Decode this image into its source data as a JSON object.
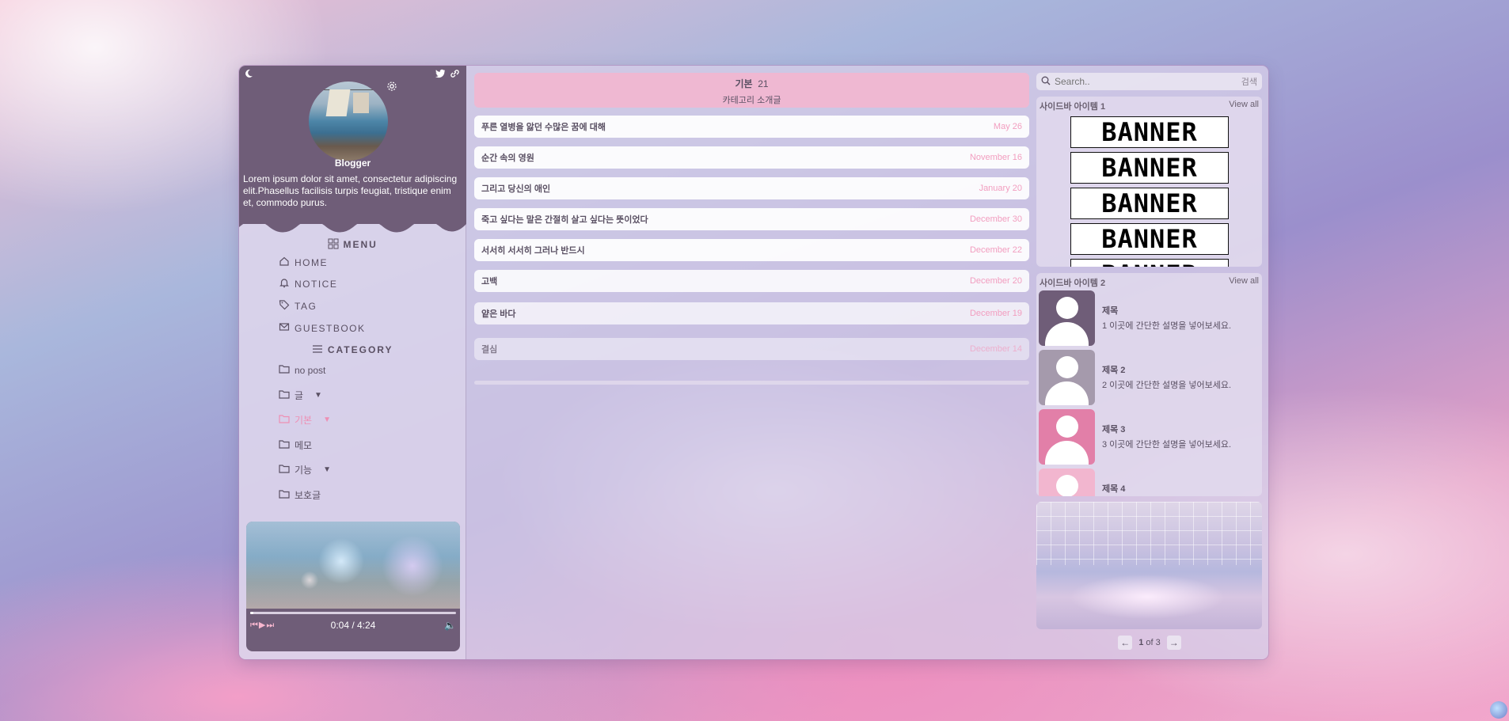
{
  "profile": {
    "name": "Blogger",
    "description": "Lorem ipsum dolor sit amet, consectetur adipiscing elit.Phasellus facilisis turpis feugiat, tristique enim et, commodo purus.",
    "icons": {
      "theme": "moon-icon",
      "twitter": "twitter-icon",
      "link": "link-icon",
      "settings": "gear-icon"
    }
  },
  "menu": {
    "title": "MENU",
    "items": [
      {
        "label": "HOME",
        "icon": "home-icon"
      },
      {
        "label": "NOTICE",
        "icon": "bell-icon"
      },
      {
        "label": "TAG",
        "icon": "tag-icon"
      },
      {
        "label": "GUESTBOOK",
        "icon": "mail-icon"
      }
    ]
  },
  "category": {
    "title": "CATEGORY",
    "items": [
      {
        "label": "no post",
        "icon": "folder-icon"
      },
      {
        "label": "글",
        "icon": "folder-icon",
        "expandable": true
      },
      {
        "label": "기본",
        "icon": "folder-icon",
        "expandable": true,
        "active": true
      },
      {
        "label": "메모",
        "icon": "folder-icon"
      },
      {
        "label": "기능",
        "icon": "folder-icon",
        "expandable": true
      },
      {
        "label": "보호글",
        "icon": "folder-icon"
      }
    ]
  },
  "player": {
    "time": "0:04 / 4:24",
    "progress": 0.015
  },
  "main": {
    "category_name": "기본",
    "category_count": "21",
    "category_intro": "카테고리 소개글",
    "posts": [
      {
        "title": "푸른 열병을 앓던 수많은 꿈에 대해",
        "date": "May 26"
      },
      {
        "title": "순간 속의 영원",
        "date": "November 16"
      },
      {
        "title": "그리고 당신의 애인",
        "date": "January 20"
      },
      {
        "title": "죽고 싶다는 말은 간절히 살고 싶다는 뜻이었다",
        "date": "December 30"
      },
      {
        "title": "서서히 서서히 그러나 반드시",
        "date": "December 22"
      },
      {
        "title": "고백",
        "date": "December 20"
      },
      {
        "title": "얕은 바다",
        "date": "December 19"
      },
      {
        "title": "결심",
        "date": "December 14"
      }
    ]
  },
  "search": {
    "placeholder": "Search..",
    "button": "검색"
  },
  "sidebar1": {
    "title": "사이드바 아이템 1",
    "view_all": "View all",
    "banner_text": "BANNER"
  },
  "sidebar2": {
    "title": "사이드바 아이템 2",
    "view_all": "View all",
    "items": [
      {
        "title": "제목",
        "desc": "1 이곳에 간단한 설명을 넣어보세요.",
        "color": "#6f5d78"
      },
      {
        "title": "제목 2",
        "desc": "2 이곳에 간단한 설명을 넣어보세요.",
        "color": "#a59aac"
      },
      {
        "title": "제목 3",
        "desc": "3 이곳에 간단한 설명을 넣어보세요.",
        "color": "#e27fa8"
      },
      {
        "title": "제목 4",
        "desc": "",
        "color": "#f2b6cf"
      }
    ]
  },
  "pager": {
    "current": "1",
    "of_text": "of 3"
  },
  "colors": {
    "accent": "#ee8fb4",
    "profile_bg": "#6f5d78",
    "header_pink": "#efb8d2"
  }
}
